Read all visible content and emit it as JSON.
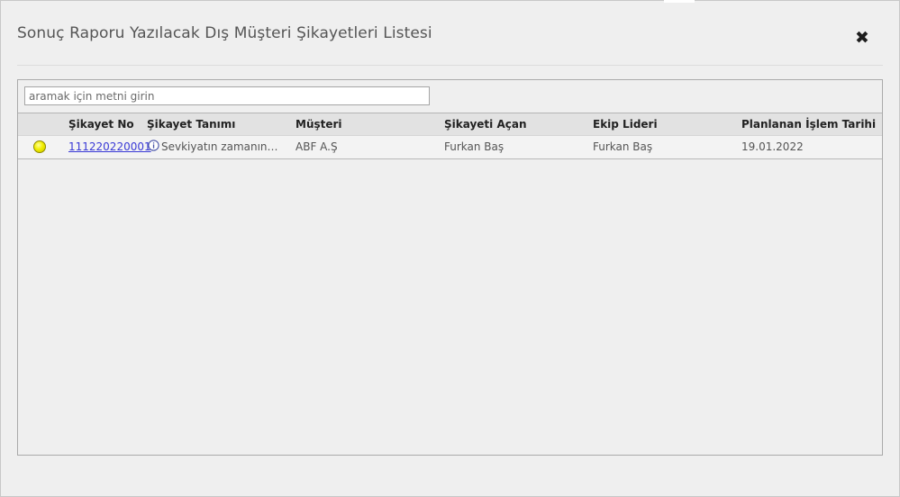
{
  "dialog": {
    "title": "Sonuç Raporu Yazılacak Dış Müşteri Şikayetleri Listesi",
    "close_label": "✖"
  },
  "search": {
    "placeholder": "aramak için metni girin",
    "value": ""
  },
  "table": {
    "columns": {
      "complaint_no": "Şikayet No",
      "description": "Şikayet Tanımı",
      "customer": "Müşteri",
      "opened_by": "Şikayeti Açan",
      "team_lead": "Ekip Lideri",
      "planned_date": "Planlanan İşlem Tarihi"
    },
    "rows": [
      {
        "status_color": "#f2ee00",
        "complaint_no": "111220220001",
        "description": "Sevkiyatın zamanında gerçekleşmemesi",
        "customer": "ABF A.Ş",
        "opened_by": "Furkan Baş",
        "team_lead": "Furkan Baş",
        "planned_date": "19.01.2022"
      }
    ]
  },
  "icons": {
    "close": "close-icon",
    "info": "info-icon",
    "status": "status-dot-icon"
  },
  "colors": {
    "link": "#3a3ad6",
    "status_yellow": "#f2ee00",
    "header_bg": "#e2e2e2"
  }
}
